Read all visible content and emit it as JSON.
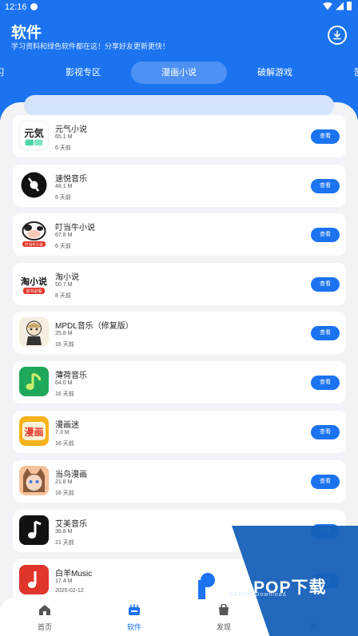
{
  "status_bar": {
    "time": "12:16"
  },
  "header": {
    "title": "软件",
    "subtitle": "学习资料和绿色软件都在这！分享好友更新更快！"
  },
  "tabs": [
    {
      "label": "习"
    },
    {
      "label": "影视专区"
    },
    {
      "label": "漫画小说"
    },
    {
      "label": "破解游戏"
    },
    {
      "label": "苦"
    }
  ],
  "apps": [
    {
      "name": "元气小说",
      "size": "65.1 M",
      "date": "6 天前",
      "button": "查看"
    },
    {
      "name": "速悦音乐",
      "size": "48.1 M",
      "date": "6 天前",
      "button": "查看"
    },
    {
      "name": "叮当牛小说",
      "size": "67.8 M",
      "date": "6 天前",
      "button": "查看"
    },
    {
      "name": "淘小说",
      "size": "50.7 M",
      "date": "8 天前",
      "button": "查看"
    },
    {
      "name": "MPDL音乐（修复版）",
      "size": "25.8 M",
      "date": "16 天前",
      "button": "查看"
    },
    {
      "name": "薄荷音乐",
      "size": "64.0 M",
      "date": "16 天前",
      "button": "查看"
    },
    {
      "name": "漫画迷",
      "size": "7.3 M",
      "date": "16 天前",
      "button": "查看"
    },
    {
      "name": "当鸟漫画",
      "size": "21.8 M",
      "date": "16 天前",
      "button": "查看"
    },
    {
      "name": "艾美音乐",
      "size": "36.8 M",
      "date": "21 天前",
      "button": "查看"
    },
    {
      "name": "白羊Music",
      "size": "17.4 M",
      "date": "2025-02-12",
      "button": "查看"
    }
  ],
  "icon_text": {
    "yuanqi": "元気",
    "tao": "淘小说",
    "tao_sub": "追书必看",
    "manhua": "漫画",
    "dingdang_sub": "叮当牛小说"
  },
  "bottom_nav": [
    {
      "label": "首页"
    },
    {
      "label": "软件"
    },
    {
      "label": "发现"
    },
    {
      "label": "更"
    }
  ],
  "watermark": {
    "title": "PCPOP下载",
    "subtitle": "PCPOP Download"
  },
  "colors": {
    "accent": "#1b73f0",
    "background": "#f1f3f6",
    "card": "#ffffff"
  }
}
